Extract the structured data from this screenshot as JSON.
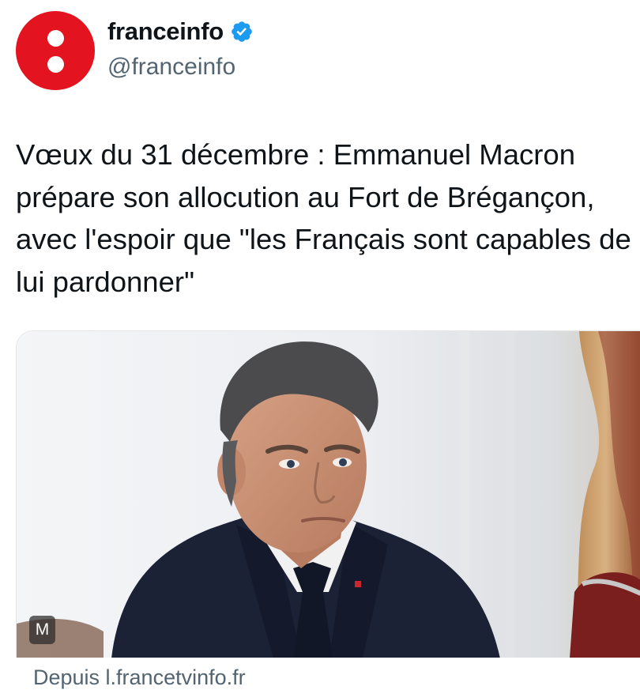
{
  "account": {
    "display_name": "franceinfo",
    "handle": "@franceinfo",
    "verified": true,
    "avatar_color": "#e3141f"
  },
  "tweet": {
    "text": "Vœux du 31 décembre : Emmanuel Macron prépare son allocution au Fort de Brégançon, avec l'espoir que \"les Français sont capables de lui pardonner\""
  },
  "card": {
    "badge": "M",
    "source_text": "Depuis l.francetvinfo.fr"
  },
  "colors": {
    "text": "#0f1419",
    "secondary": "#536471",
    "verified_blue": "#1d9bf0"
  }
}
